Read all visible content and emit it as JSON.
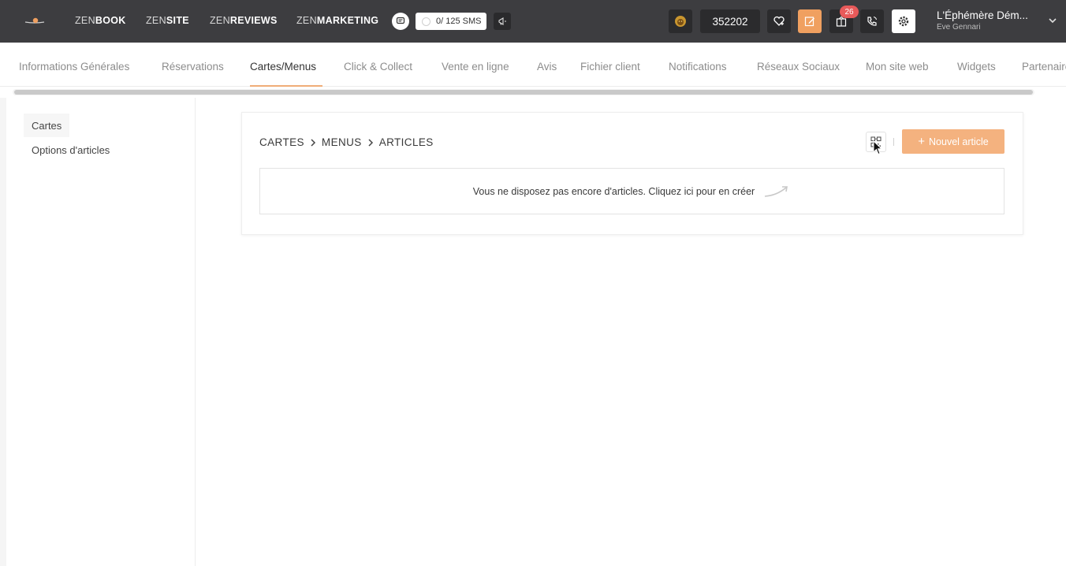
{
  "topbar": {
    "brands": [
      {
        "prefix": "ZEN",
        "suffix": "BOOK"
      },
      {
        "prefix": "ZEN",
        "suffix": "SITE"
      },
      {
        "prefix": "ZEN",
        "suffix": "REVIEWS"
      },
      {
        "prefix": "ZEN",
        "suffix": "MARKETING"
      }
    ],
    "sms_counter": "0/ 125 SMS",
    "restaurant_id": "352202",
    "notification_count": "26",
    "account_name": "L'Éphémère Dém...",
    "account_user": "Eve Gennari",
    "colors": {
      "bar": "#3d3d40",
      "accent": "#f0a060",
      "badge": "#e85a5a"
    }
  },
  "tabs": {
    "items": [
      "Informations Générales",
      "Réservations",
      "Cartes/Menus",
      "Click & Collect",
      "Vente en ligne",
      "Avis",
      "Fichier client",
      "Notifications",
      "Réseaux Sociaux",
      "Mon site web",
      "Widgets",
      "Partenaires"
    ],
    "active": "Cartes/Menus"
  },
  "sidebar": {
    "items": [
      "Cartes",
      "Options d'articles"
    ],
    "active": "Cartes"
  },
  "main": {
    "breadcrumb": [
      "CARTES",
      "MENUS",
      "ARTICLES"
    ],
    "new_button_label": "Nouvel article",
    "empty_message": "Vous ne disposez pas encore d'articles. Cliquez ici pour en créer",
    "accent_color": "#f4b27f"
  }
}
